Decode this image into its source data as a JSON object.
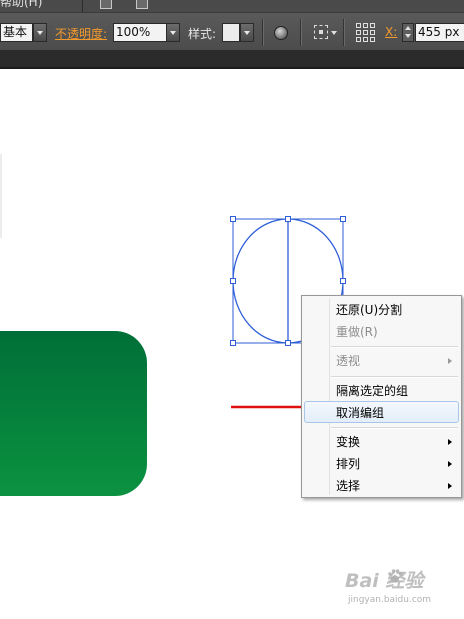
{
  "menubar": {
    "help_menu": "帮助(H)"
  },
  "controlbar": {
    "style_preset_value": "基本",
    "opacity_label": "不透明度:",
    "opacity_value": "100%",
    "style_label": "样式:",
    "x_label": "X:",
    "x_value": "455 px"
  },
  "context_menu": {
    "items": [
      {
        "label": "还原(U)分割",
        "enabled": true
      },
      {
        "label": "重做(R)",
        "enabled": false
      },
      {
        "label": "透视",
        "enabled": false,
        "submenu": true
      },
      {
        "label": "隔离选定的组",
        "enabled": true
      },
      {
        "label": "取消编组",
        "enabled": true,
        "hovered": true
      },
      {
        "label": "变换",
        "enabled": true,
        "submenu": true
      },
      {
        "label": "排列",
        "enabled": true,
        "submenu": true
      },
      {
        "label": "选择",
        "enabled": true,
        "submenu": true
      }
    ]
  },
  "artwork": {
    "selection_color": "#2e5fd6",
    "shape_fill_color": "#00803c",
    "annotation_arrow_color": "#e01010"
  },
  "watermark": {
    "logo_text": "Bai  经验",
    "url_text": "jingyan.baidu.com"
  }
}
